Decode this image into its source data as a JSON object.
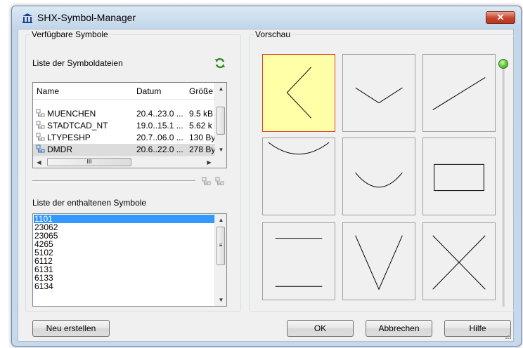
{
  "window": {
    "title": "SHX-Symbol-Manager",
    "close_glyph": "✕"
  },
  "left_group": {
    "legend": "Verfügbare Symbole",
    "files_label": "Liste der Symboldateien",
    "columns": [
      "Name",
      "Datum",
      "Größe"
    ],
    "files": [
      {
        "name": "MUENCHEN",
        "date": "20.4..23.0 ...",
        "size": "9.5 kB",
        "selected": false
      },
      {
        "name": "STADTCAD_NT",
        "date": "19.0..15.1 ...",
        "size": "5.62 k",
        "selected": false
      },
      {
        "name": "LTYPESHP",
        "date": "20.7..06.0 ...",
        "size": "130 By",
        "selected": false
      },
      {
        "name": "DMDR",
        "date": "20.6..22.0 ...",
        "size": "278 By",
        "selected": true
      }
    ],
    "symbols_label": "Liste der enthaltenen Symbole",
    "symbols": [
      "1101",
      "23062",
      "23065",
      "4265",
      "5102",
      "6112",
      "6131",
      "6133",
      "6134"
    ],
    "selected_symbol": "1101",
    "hscroll_grip": "III"
  },
  "preview": {
    "legend": "Vorschau",
    "selected_index": 0,
    "tiles": [
      "chevron-left",
      "chevron-down",
      "diagonal-line",
      "arc-top",
      "arc-bottom",
      "rectangle",
      "two-hlines",
      "v-shape",
      "x-shape"
    ]
  },
  "buttons": {
    "new": "Neu erstellen",
    "ok": "OK",
    "cancel": "Abbrechen",
    "help": "Hilfe"
  },
  "colors": {
    "selection_blue": "#3399ff",
    "preview_selected_fill": "#ffffa8",
    "preview_selected_border": "#e03c2c",
    "close_red": "#c7432a",
    "slider_green": "#6dd043"
  }
}
